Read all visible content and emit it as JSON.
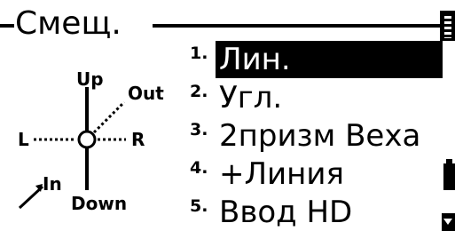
{
  "screen": {
    "title": "Смещ."
  },
  "diagram": {
    "up": "Up",
    "out": "Out",
    "left": "L",
    "right": "R",
    "in": "In",
    "down": "Down"
  },
  "menu": {
    "items": [
      {
        "num": "1.",
        "label": "Лин.",
        "selected": true
      },
      {
        "num": "2.",
        "label": "Угл.",
        "selected": false
      },
      {
        "num": "3.",
        "label": "2призм Веха",
        "selected": false
      },
      {
        "num": "4.",
        "label": "+Линия",
        "selected": false
      },
      {
        "num": "5.",
        "label": "Ввод HD",
        "selected": false
      }
    ]
  },
  "icons": {
    "battery": "battery-icon",
    "scroll_down": "scroll-down-icon",
    "scroll_bar": "scrollbar-icon"
  },
  "colors": {
    "foreground": "#000000",
    "background": "#ffffff",
    "highlight_bg": "#000000",
    "highlight_fg": "#ffffff"
  }
}
